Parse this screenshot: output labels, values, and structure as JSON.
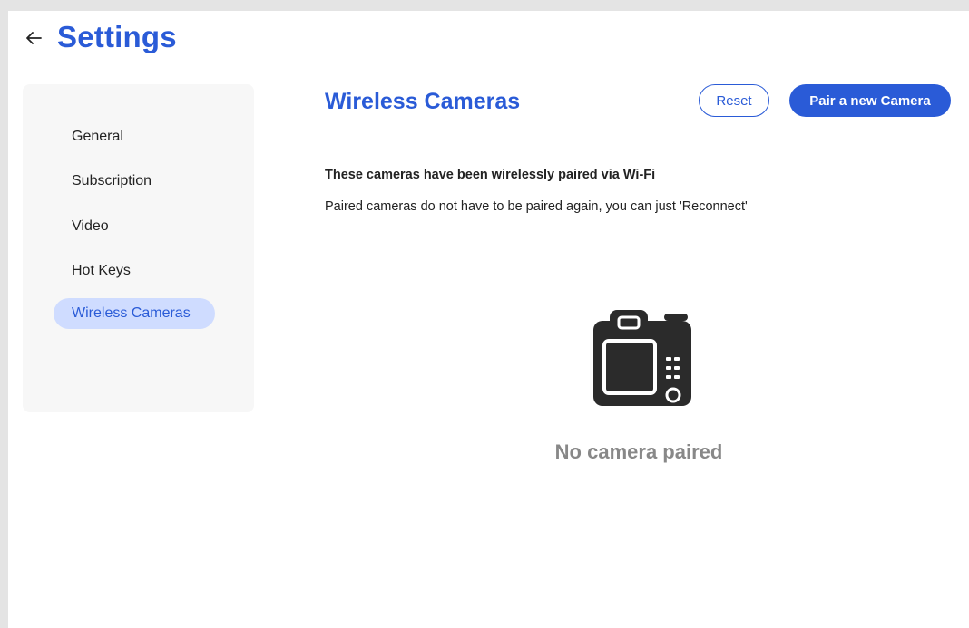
{
  "header": {
    "title": "Settings",
    "back_icon": "arrow-left-icon"
  },
  "sidebar": {
    "items": [
      {
        "label": "General",
        "active": false
      },
      {
        "label": "Subscription",
        "active": false
      },
      {
        "label": "Video",
        "active": false
      },
      {
        "label": "Hot Keys",
        "active": false
      },
      {
        "label": "Wireless Cameras",
        "active": true
      }
    ]
  },
  "main": {
    "title": "Wireless Cameras",
    "reset_label": "Reset",
    "pair_label": "Pair a new Camera",
    "description_bold": "These cameras have been wirelessly paired via Wi-Fi",
    "description": "Paired cameras do not have to be paired again, you can just 'Reconnect'",
    "empty_icon": "camera-icon",
    "empty_text": "No camera paired"
  },
  "colors": {
    "accent": "#2a5bd7",
    "active_nav_bg": "#cfdcff",
    "sidebar_bg": "#f7f7f7",
    "muted_text": "#888888",
    "icon": "#2b2b2b"
  }
}
